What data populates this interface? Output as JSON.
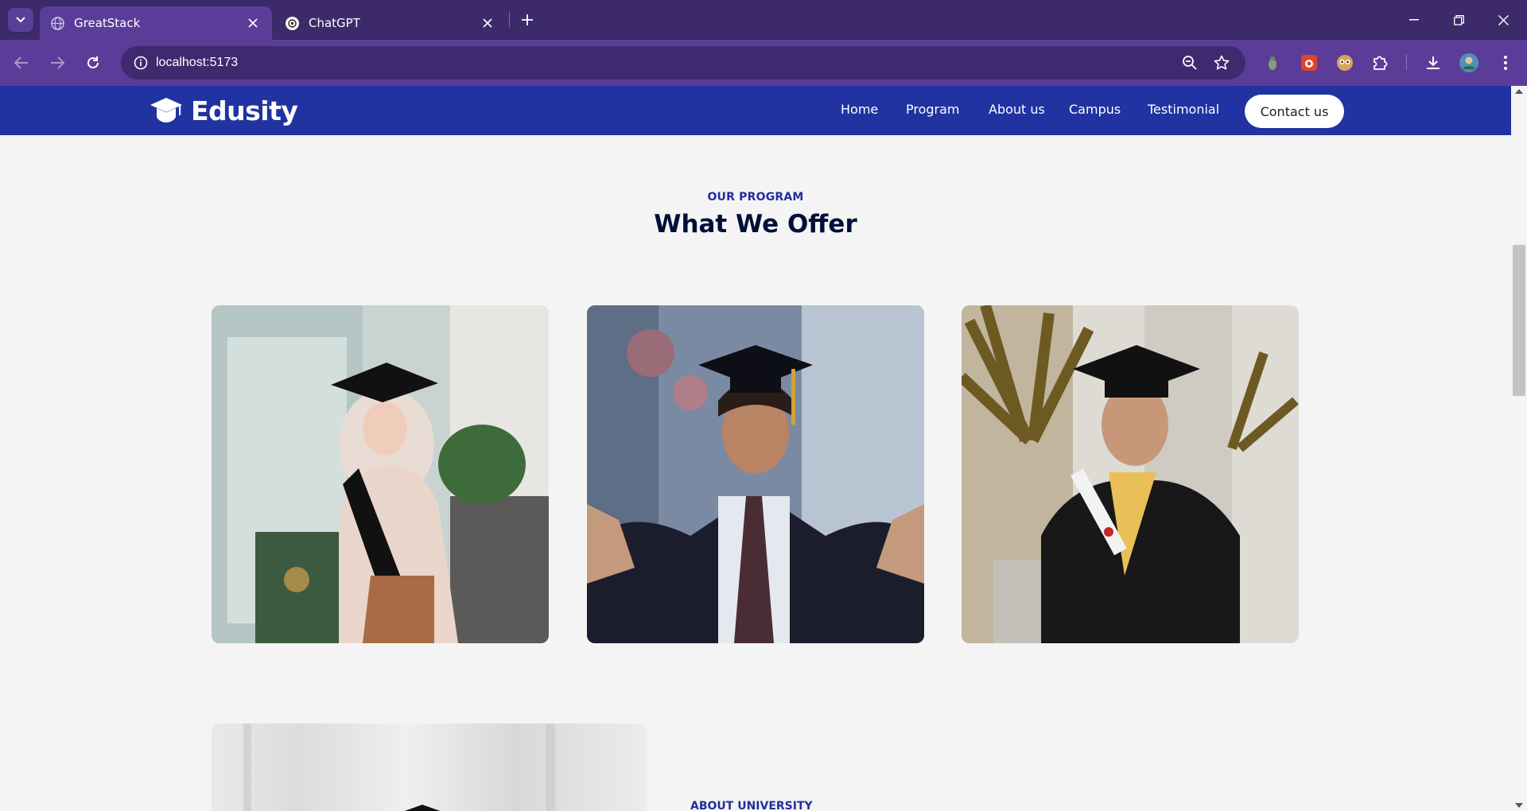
{
  "browser": {
    "tabs": [
      {
        "title": "GreatStack",
        "active": true
      },
      {
        "title": "ChatGPT",
        "active": false
      }
    ],
    "url": "localhost:5173"
  },
  "site": {
    "logo": "Edusity",
    "nav": [
      "Home",
      "Program",
      "About us",
      "Campus",
      "Testimonial"
    ],
    "contact_label": "Contact us"
  },
  "programs": {
    "subtitle": "OUR PROGRAM",
    "title": "What We Offer"
  },
  "about": {
    "subtitle": "ABOUT UNIVERSITY"
  },
  "colors": {
    "nav_bg": "#2033a0",
    "accent": "#212ea0",
    "heading": "#000f38",
    "page_bg": "#f4f4f4",
    "chrome": "#5b3d99"
  }
}
